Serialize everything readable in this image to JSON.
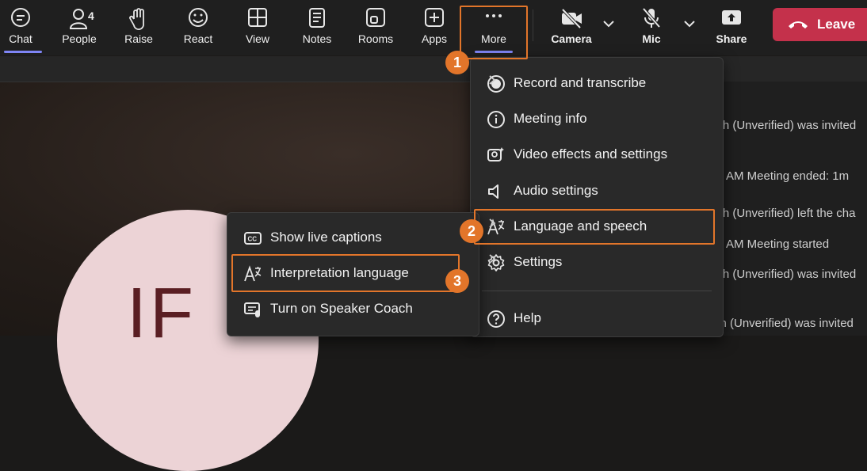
{
  "toolbar": {
    "items": [
      {
        "label": "Chat",
        "icon": "chat-icon"
      },
      {
        "label": "People",
        "icon": "people-icon",
        "badge": "4"
      },
      {
        "label": "Raise",
        "icon": "raise-hand-icon"
      },
      {
        "label": "React",
        "icon": "smiley-icon"
      },
      {
        "label": "View",
        "icon": "grid-icon"
      },
      {
        "label": "Notes",
        "icon": "notes-icon"
      },
      {
        "label": "Rooms",
        "icon": "rooms-icon"
      },
      {
        "label": "Apps",
        "icon": "apps-plus-icon"
      },
      {
        "label": "More",
        "icon": "ellipsis-icon"
      }
    ],
    "camera_label": "Camera",
    "mic_label": "Mic",
    "share_label": "Share",
    "leave_label": "Leave"
  },
  "more_menu": {
    "items": [
      {
        "label": "Record and transcribe",
        "icon": "record-icon",
        "has_submenu": true
      },
      {
        "label": "Meeting info",
        "icon": "info-icon",
        "has_submenu": false
      },
      {
        "label": "Video effects and settings",
        "icon": "video-effects-icon",
        "has_submenu": false
      },
      {
        "label": "Audio settings",
        "icon": "speaker-icon",
        "has_submenu": false
      },
      {
        "label": "Language and speech",
        "icon": "language-icon",
        "has_submenu": true
      },
      {
        "label": "Settings",
        "icon": "gear-icon",
        "has_submenu": true
      },
      {
        "label": "Help",
        "icon": "help-icon",
        "has_submenu": false
      }
    ]
  },
  "language_submenu": {
    "items": [
      {
        "label": "Show live captions",
        "icon": "captions-icon"
      },
      {
        "label": "Interpretation language",
        "icon": "interpretation-icon"
      },
      {
        "label": "Turn on Speaker Coach",
        "icon": "speaker-coach-icon"
      }
    ]
  },
  "chat_panel": {
    "lines": [
      "ish (Unverified) was invited",
      "AM   Meeting ended: 1m",
      "ish (Unverified) left the cha",
      "AM   Meeting started",
      "ish (Unverified) was invited",
      "ch (Unverified) was invited"
    ]
  },
  "avatar": {
    "initials": "IF"
  },
  "callouts": [
    "1",
    "2",
    "3"
  ],
  "colors": {
    "accent": "#e2752a",
    "leave": "#c4314b",
    "active_underline": "#7f85f5"
  }
}
